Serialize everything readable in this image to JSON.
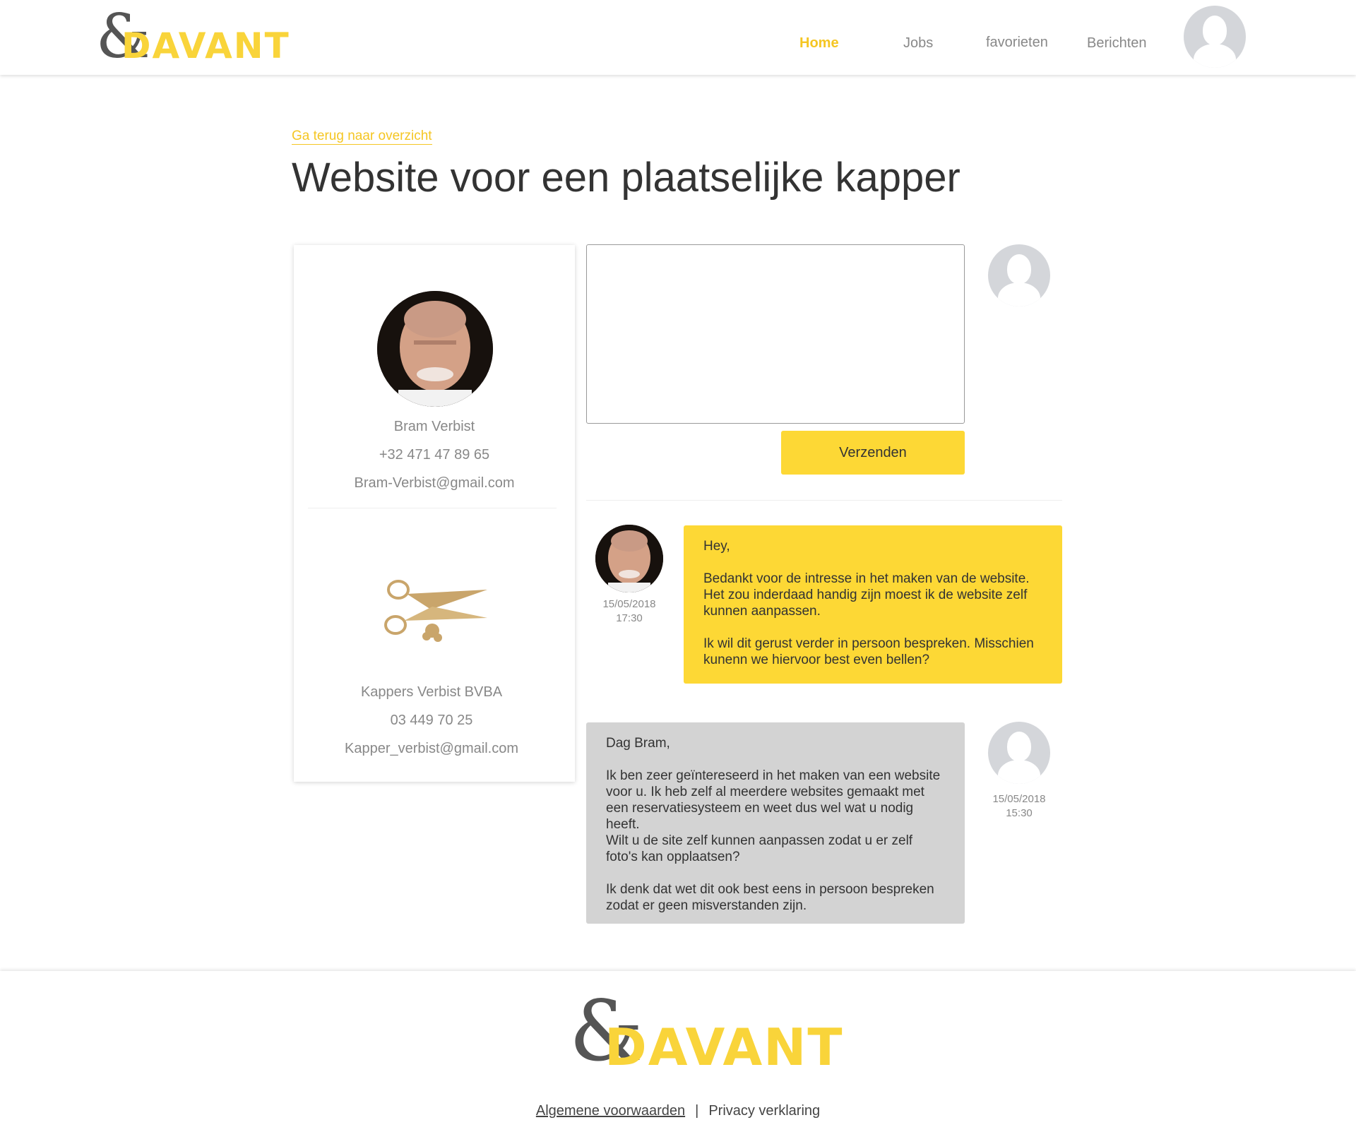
{
  "brand": {
    "ampersand": "&",
    "name": "DAVANT",
    "accent_color": "#fdd835"
  },
  "nav": {
    "items": [
      {
        "label": "Home",
        "active": true
      },
      {
        "label": "Jobs",
        "active": false
      },
      {
        "label": "favorieten",
        "active": false
      },
      {
        "label": "Berichten",
        "active": false
      }
    ],
    "avatar_icon": "user-avatar-icon"
  },
  "page": {
    "back_link": "Ga terug naar overzicht",
    "title": "Website voor een plaatselijke kapper"
  },
  "contact": {
    "person": {
      "name": "Bram Verbist",
      "phone": "+32 471 47 89 65",
      "email": "Bram-Verbist@gmail.com"
    },
    "company": {
      "name": "Kappers Verbist BVBA",
      "phone": "03 449 70 25",
      "email": "Kapper_verbist@gmail.com",
      "logo_icon": "scissors-icon"
    }
  },
  "compose": {
    "placeholder": "",
    "send_label": "Verzenden"
  },
  "messages": [
    {
      "from": "Bram Verbist",
      "date": "15/05/2018",
      "time": "17:30",
      "text": "Hey,\n\nBedankt voor de intresse in het maken van de website. Het zou inderdaad handig zijn moest ik de website zelf kunnen aanpassen.\n\nIk wil dit gerust verder in persoon bespreken. Misschien kunenn we hiervoor best even bellen?"
    },
    {
      "from": "me",
      "date": "15/05/2018",
      "time": "15:30",
      "text": "Dag Bram,\n\nIk ben zeer geïntereseerd in het maken van een website voor u. Ik heb zelf al meerdere websites gemaakt met een reservatiesysteem en weet dus wel wat u nodig heeft.\nWilt u de site zelf kunnen aanpassen zodat u er zelf foto's kan opplaatsen?\n\nIk denk dat wet dit ook best eens in persoon bespreken zodat er geen misverstanden zijn."
    }
  ],
  "footer": {
    "terms": "Algemene voorwaarden",
    "separator": "|",
    "privacy": "Privacy verklaring"
  }
}
